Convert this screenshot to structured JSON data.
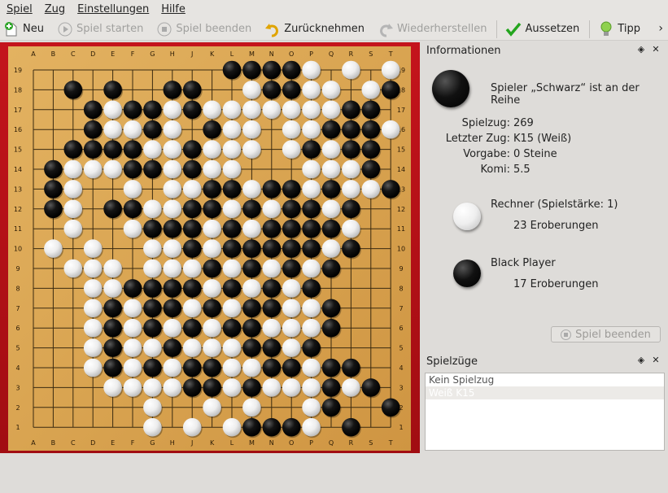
{
  "menu": [
    "Spiel",
    "Zug",
    "Einstellungen",
    "Hilfe"
  ],
  "toolbar": {
    "new": "Neu",
    "start": "Spiel starten",
    "end": "Spiel beenden",
    "undo": "Zurücknehmen",
    "redo": "Wiederherstellen",
    "pass": "Aussetzen",
    "hint": "Tipp"
  },
  "board": {
    "columns": [
      "A",
      "B",
      "C",
      "D",
      "E",
      "F",
      "G",
      "H",
      "J",
      "K",
      "L",
      "M",
      "N",
      "O",
      "P",
      "Q",
      "R",
      "S",
      "T"
    ],
    "rows": [
      "19",
      "18",
      "17",
      "16",
      "15",
      "14",
      "13",
      "12",
      "11",
      "10",
      "9",
      "8",
      "7",
      "6",
      "5",
      "4",
      "3",
      "2",
      "1"
    ],
    "stones": [
      "..........BBBBW.W.W",
      "..B.B..BB..WBBWW.WB",
      "...BWBBWBWWWWWWWBB",
      "...BWWBW.BWW.WWBBBW",
      "..BBBBWWBWWW.WBWBB.",
      ".BWWWBBWBWW...WWWB.",
      ".BW..W.WWBBWBBWBWWB",
      ".BW.BBWWBBWBWBBWB..",
      "..W..WBBBWBWBBBBW..",
      ".W.W..WWBWBBBBBWB..",
      "..WWW.WWWBWBWBWB...",
      "...WWBBBBWBWBWB....",
      "...WBWBBWBWBBWWB...",
      "...WBWBWBWBBWWWB...",
      "...WBWWBWWWBBWB....",
      "...WBWBWBBWWBBWBB..",
      "....WWWWBBWBWWWBWB.",
      "......W..W.W..WB..B",
      "......W.W.WBBBW.B.."
    ]
  },
  "info": {
    "title": "Informationen",
    "turn": "Spieler „Schwarz“ ist an der Reihe",
    "move_label": "Spielzug:",
    "move_value": "269",
    "last_label": "Letzter Zug:",
    "last_value": "K15 (Weiß)",
    "handicap_label": "Vorgabe:",
    "handicap_value": "0 Steine",
    "komi_label": "Komi:",
    "komi_value": "5.5",
    "white_player": "Rechner (Spielstärke: 1)",
    "white_captures": "23 Eroberungen",
    "black_player": "Black Player",
    "black_captures": "17 Eroberungen",
    "end_button": "Spiel beenden"
  },
  "moves": {
    "title": "Spielzüge",
    "items": [
      "Kein Spielzug",
      "Weiß K15"
    ]
  },
  "colors": {
    "board_wood": "#d9a451",
    "frame_red": "#b8111a",
    "accent_green": "#24a51e"
  }
}
